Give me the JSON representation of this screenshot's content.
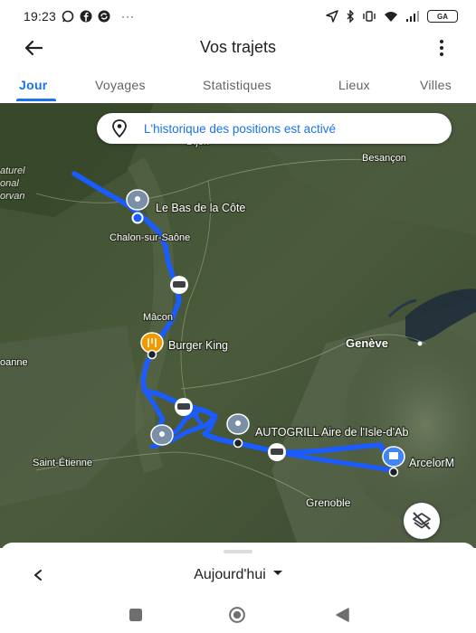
{
  "status_bar": {
    "time": "19:23",
    "notification_icons": [
      "whatsapp-icon",
      "facebook-icon",
      "sync-icon",
      "more-notifications-icon"
    ],
    "more_notifications": "···",
    "system_icons": [
      "location-arrow-icon",
      "bluetooth-icon",
      "vibrate-icon",
      "wifi-icon",
      "signal-icon"
    ],
    "battery_label": "GA"
  },
  "app_bar": {
    "title": "Vos trajets",
    "back_icon": "arrow-back-icon",
    "menu_icon": "more-vert-icon"
  },
  "tabs": [
    {
      "label": "Jour",
      "active": true
    },
    {
      "label": "Voyages",
      "active": false
    },
    {
      "label": "Statistiques",
      "active": false
    },
    {
      "label": "Lieux",
      "active": false
    },
    {
      "label": "Villes",
      "active": false
    }
  ],
  "map": {
    "history_banner": "L'historique des positions est activé",
    "labels": {
      "dijon": "Dijon",
      "besancon": "Besançon",
      "naturel": "aturel",
      "onal": "onal",
      "orvan": "orvan",
      "le_bas": "Le Bas de la Côte",
      "chalon": "Chalon-sur-Saône",
      "macon": "Mâcon",
      "burger_king": "Burger King",
      "geneve": "Genève",
      "roanne": "oanne",
      "autogrill": "AUTOGRILL Aire de l'Isle-d'Ab",
      "arcelor": "ArcelorM",
      "saint_etienne": "Saint-Étienne",
      "grenoble": "Grenoble"
    },
    "route_color": "#1a5cff",
    "layers_icon": "layers-off-icon"
  },
  "bottom_sheet": {
    "prev_icon": "chevron-left-icon",
    "date_label": "Aujourd'hui",
    "dropdown_icon": "caret-down-icon"
  },
  "nav_bar": {
    "recents_icon": "square-recents-icon",
    "home_icon": "circle-home-icon",
    "back_icon": "triangle-back-icon"
  }
}
